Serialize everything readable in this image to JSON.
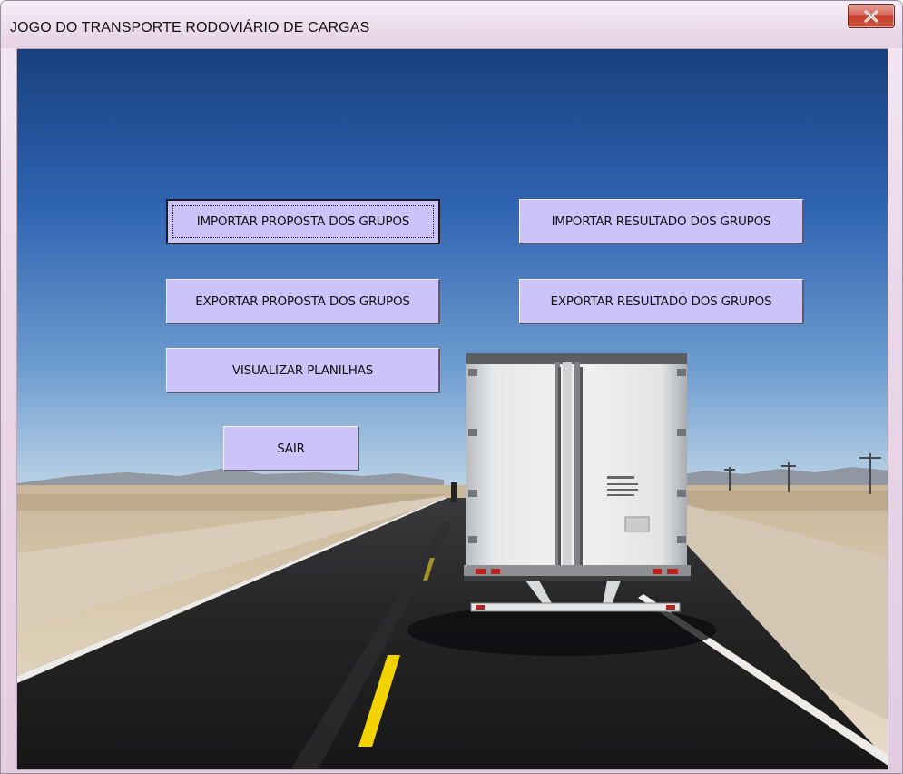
{
  "window": {
    "title": "JOGO DO TRANSPORTE RODOVIÁRIO DE CARGAS",
    "close_icon": "close-x-icon"
  },
  "buttons": {
    "importar_proposta": "IMPORTAR PROPOSTA DOS GRUPOS",
    "importar_resultado": "IMPORTAR RESULTADO DOS GRUPOS",
    "exportar_proposta": "EXPORTAR PROPOSTA DOS GRUPOS",
    "exportar_resultado": "EXPORTAR RESULTADO DOS GRUPOS",
    "visualizar_planilhas": "VISUALIZAR PLANILHAS",
    "sair": "SAIR"
  },
  "colors": {
    "button_face": "#cbc3fa",
    "close_button": "#c33d2b",
    "sky": "#2c63b3",
    "road": "#1e1e1f",
    "lane_yellow": "#f2d200"
  }
}
